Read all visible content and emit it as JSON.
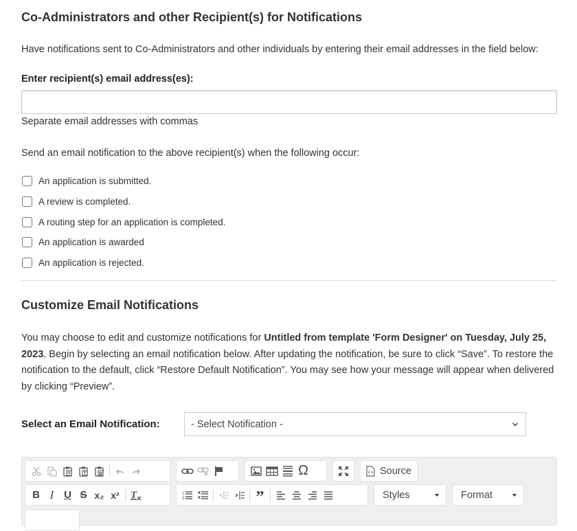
{
  "recipients_section": {
    "title": "Co-Administrators and other Recipient(s) for Notifications",
    "description": "Have notifications sent to Co-Administrators and other individuals by entering their email addresses in the field below:",
    "email_label": "Enter recipient(s) email address(es):",
    "email_value": "",
    "email_placeholder": "",
    "email_help": "Separate email addresses with commas",
    "trigger_intro": "Send an email notification to the above recipient(s) when the following occur:",
    "triggers": [
      {
        "label": "An application is submitted.",
        "checked": false
      },
      {
        "label": "A review is completed.",
        "checked": false
      },
      {
        "label": "A routing step for an application is completed.",
        "checked": false
      },
      {
        "label": "An application is awarded",
        "checked": false
      },
      {
        "label": "An application is rejected.",
        "checked": false
      }
    ]
  },
  "customize_section": {
    "title": "Customize Email Notifications",
    "desc_part1": "You may choose to edit and customize notifications for ",
    "desc_bold": "Untitled from template 'Form Designer' on Tuesday, July 25, 2023",
    "desc_part2": ". Begin by selecting an email notification below. After updating the notification, be sure to click “Save”. To restore the notification to the default, click “Restore Default Notification”. You may see how your message will appear when delivered by clicking “Preview”.",
    "select_label": "Select an Email Notification:",
    "select_value": "- Select Notification -"
  },
  "editor_toolbar": {
    "row1": [
      {
        "icon": "cut-icon",
        "enabled": false
      },
      {
        "icon": "copy-icon",
        "enabled": false
      },
      {
        "icon": "paste-icon",
        "enabled": true
      },
      {
        "icon": "paste-text-icon",
        "enabled": true
      },
      {
        "icon": "paste-word-icon",
        "enabled": true
      },
      {
        "icon": "undo-icon",
        "enabled": false
      },
      {
        "icon": "redo-icon",
        "enabled": false
      },
      {
        "icon": "link-icon",
        "enabled": true
      },
      {
        "icon": "unlink-icon",
        "enabled": false
      },
      {
        "icon": "anchor-icon",
        "enabled": true
      },
      {
        "icon": "image-icon",
        "enabled": true
      },
      {
        "icon": "table-icon",
        "enabled": true
      },
      {
        "icon": "horizontal-line-icon",
        "enabled": true
      },
      {
        "icon": "special-char-icon",
        "enabled": true
      },
      {
        "icon": "maximize-icon",
        "enabled": true
      }
    ],
    "source_label": "Source",
    "row2": [
      {
        "icon": "bold-icon",
        "glyph": "B"
      },
      {
        "icon": "italic-icon",
        "glyph": "I"
      },
      {
        "icon": "underline-icon",
        "glyph": "U"
      },
      {
        "icon": "strikethrough-icon",
        "glyph": "S"
      },
      {
        "icon": "subscript-icon",
        "glyph": "x₂"
      },
      {
        "icon": "superscript-icon",
        "glyph": "x²"
      },
      {
        "icon": "remove-format-icon",
        "glyph": "Tx"
      },
      {
        "icon": "numbered-list-icon"
      },
      {
        "icon": "bulleted-list-icon"
      },
      {
        "icon": "decrease-indent-icon",
        "enabled": false
      },
      {
        "icon": "increase-indent-icon"
      },
      {
        "icon": "blockquote-icon",
        "glyph": "”"
      },
      {
        "icon": "align-left-icon"
      },
      {
        "icon": "align-center-icon"
      },
      {
        "icon": "align-right-icon"
      },
      {
        "icon": "justify-icon"
      }
    ],
    "styles_label": "Styles",
    "format_label": "Format"
  }
}
